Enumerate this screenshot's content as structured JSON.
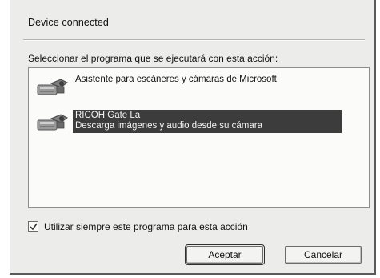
{
  "dialog": {
    "title": "Device connected",
    "prompt": "Seleccionar el programa que se ejecutará con esta acción:",
    "programs": [
      {
        "label": "Asistente para escáneres y cámaras de Microsoft",
        "icon": "camera-icon",
        "selected": false
      },
      {
        "label_line1": "RICOH Gate La",
        "label_line2": "Descarga imágenes y audio desde su cámara",
        "icon": "camera-icon",
        "selected": true
      }
    ],
    "always_use_label": "Utilizar siempre este programa para esta acción",
    "always_use_checked": true,
    "ok_label": "Aceptar",
    "cancel_label": "Cancelar"
  },
  "colors": {
    "dialog_bg": "#ececea",
    "selection_bg": "#3c3c3c",
    "listbox_bg": "#fbfbfa"
  }
}
